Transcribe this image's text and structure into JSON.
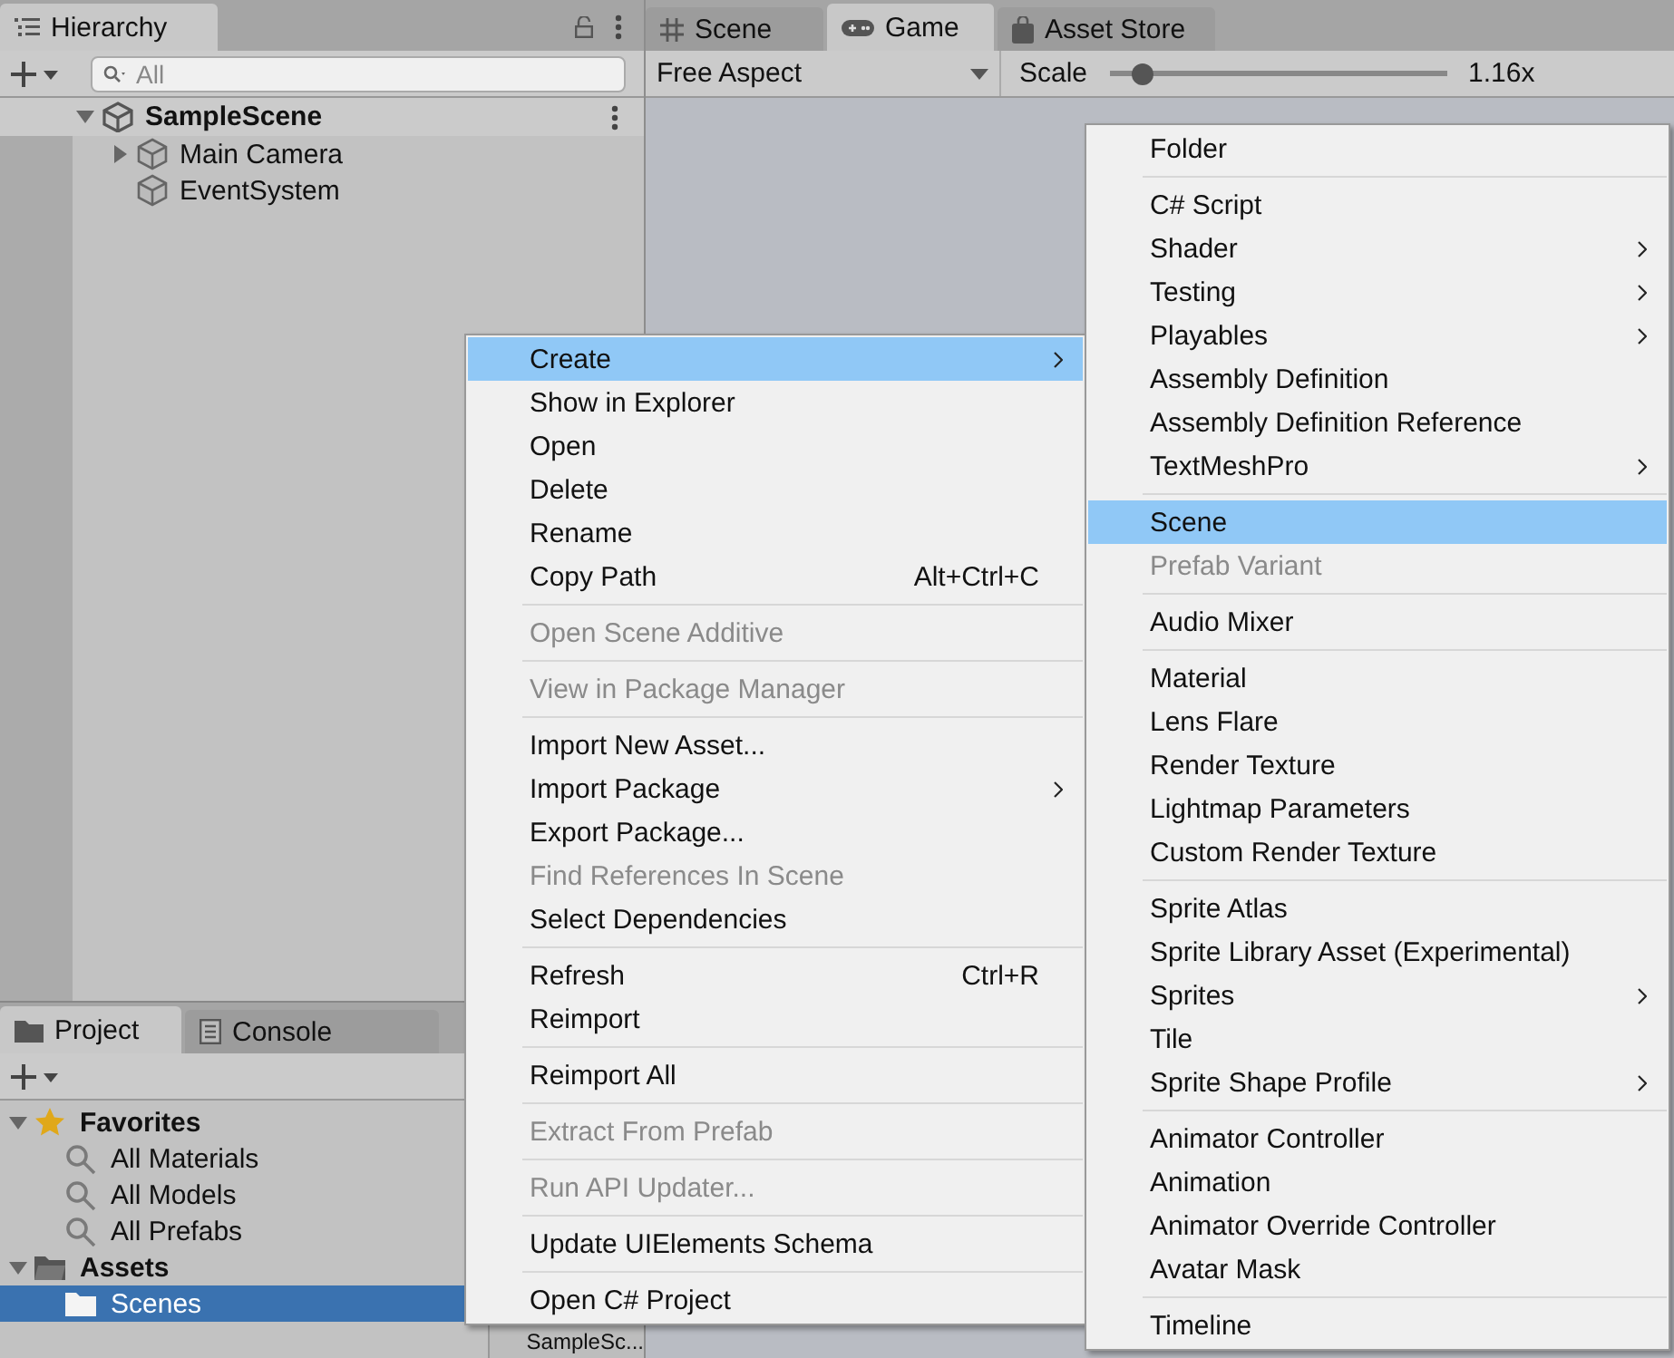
{
  "hierarchy": {
    "tabs": [
      {
        "label": "Hierarchy",
        "kind": "hierarchy",
        "selected": true
      }
    ],
    "search": {
      "placeholder": "All"
    },
    "tree": [
      {
        "label": "SampleScene",
        "kind": "scene",
        "expanded": true,
        "selected": false,
        "children": [
          {
            "label": "Main Camera",
            "kind": "gameobject",
            "expanded": false,
            "selected": false
          },
          {
            "label": "EventSystem",
            "kind": "gameobject",
            "selected": false
          }
        ]
      }
    ]
  },
  "view_tabs": [
    {
      "label": "Scene",
      "kind": "scene",
      "selected": false
    },
    {
      "label": "Game",
      "kind": "game",
      "selected": true
    },
    {
      "label": "Asset Store",
      "kind": "store",
      "selected": false
    }
  ],
  "game_toolbar": {
    "aspect": "Free Aspect",
    "scale_label": "Scale",
    "scale": {
      "level": 0.1
    },
    "scale_reading": "1.16x"
  },
  "project": {
    "tabs": [
      {
        "label": "Project",
        "kind": "project",
        "selected": true
      },
      {
        "label": "Console",
        "kind": "console",
        "selected": false
      }
    ],
    "tree": [
      {
        "label": "Favorites",
        "kind": "favorites",
        "expanded": true,
        "selected": false,
        "children": [
          {
            "label": "All Materials",
            "kind": "filter",
            "selected": false
          },
          {
            "label": "All Models",
            "kind": "filter",
            "selected": false
          },
          {
            "label": "All Prefabs",
            "kind": "filter",
            "selected": false
          }
        ]
      },
      {
        "label": "Assets",
        "kind": "folder",
        "expanded": true,
        "selected": false,
        "children": [
          {
            "label": "Scenes",
            "kind": "folder",
            "selected": true
          }
        ]
      }
    ],
    "assets": [
      {
        "label": "SampleSc..."
      }
    ]
  },
  "context_menu": [
    {
      "kind": "item",
      "label": "Create",
      "selected": true,
      "disabled": false,
      "submenu": true
    },
    {
      "kind": "item",
      "label": "Show in Explorer",
      "selected": false,
      "disabled": false,
      "submenu": false
    },
    {
      "kind": "item",
      "label": "Open",
      "selected": false,
      "disabled": false,
      "submenu": false
    },
    {
      "kind": "item",
      "label": "Delete",
      "selected": false,
      "disabled": false,
      "submenu": false
    },
    {
      "kind": "item",
      "label": "Rename",
      "selected": false,
      "disabled": false,
      "submenu": false
    },
    {
      "kind": "item",
      "label": "Copy Path",
      "shortcut": "Alt+Ctrl+C",
      "selected": false,
      "disabled": false,
      "submenu": false
    },
    {
      "kind": "separator"
    },
    {
      "kind": "item",
      "label": "Open Scene Additive",
      "selected": false,
      "disabled": true,
      "submenu": false
    },
    {
      "kind": "separator"
    },
    {
      "kind": "item",
      "label": "View in Package Manager",
      "selected": false,
      "disabled": true,
      "submenu": false
    },
    {
      "kind": "separator"
    },
    {
      "kind": "item",
      "label": "Import New Asset...",
      "selected": false,
      "disabled": false,
      "submenu": false
    },
    {
      "kind": "item",
      "label": "Import Package",
      "selected": false,
      "disabled": false,
      "submenu": true
    },
    {
      "kind": "item",
      "label": "Export Package...",
      "selected": false,
      "disabled": false,
      "submenu": false
    },
    {
      "kind": "item",
      "label": "Find References In Scene",
      "selected": false,
      "disabled": true,
      "submenu": false
    },
    {
      "kind": "item",
      "label": "Select Dependencies",
      "selected": false,
      "disabled": false,
      "submenu": false
    },
    {
      "kind": "separator"
    },
    {
      "kind": "item",
      "label": "Refresh",
      "shortcut": "Ctrl+R",
      "selected": false,
      "disabled": false,
      "submenu": false
    },
    {
      "kind": "item",
      "label": "Reimport",
      "selected": false,
      "disabled": false,
      "submenu": false
    },
    {
      "kind": "separator"
    },
    {
      "kind": "item",
      "label": "Reimport All",
      "selected": false,
      "disabled": false,
      "submenu": false
    },
    {
      "kind": "separator"
    },
    {
      "kind": "item",
      "label": "Extract From Prefab",
      "selected": false,
      "disabled": true,
      "submenu": false
    },
    {
      "kind": "separator"
    },
    {
      "kind": "item",
      "label": "Run API Updater...",
      "selected": false,
      "disabled": true,
      "submenu": false
    },
    {
      "kind": "separator"
    },
    {
      "kind": "item",
      "label": "Update UIElements Schema",
      "selected": false,
      "disabled": false,
      "submenu": false
    },
    {
      "kind": "separator"
    },
    {
      "kind": "item",
      "label": "Open C# Project",
      "selected": false,
      "disabled": false,
      "submenu": false
    }
  ],
  "create_submenu": [
    {
      "kind": "item",
      "label": "Folder",
      "selected": false,
      "disabled": false,
      "submenu": false
    },
    {
      "kind": "separator"
    },
    {
      "kind": "item",
      "label": "C# Script",
      "selected": false,
      "disabled": false,
      "submenu": false
    },
    {
      "kind": "item",
      "label": "Shader",
      "selected": false,
      "disabled": false,
      "submenu": true
    },
    {
      "kind": "item",
      "label": "Testing",
      "selected": false,
      "disabled": false,
      "submenu": true
    },
    {
      "kind": "item",
      "label": "Playables",
      "selected": false,
      "disabled": false,
      "submenu": true
    },
    {
      "kind": "item",
      "label": "Assembly Definition",
      "selected": false,
      "disabled": false,
      "submenu": false
    },
    {
      "kind": "item",
      "label": "Assembly Definition Reference",
      "selected": false,
      "disabled": false,
      "submenu": false
    },
    {
      "kind": "item",
      "label": "TextMeshPro",
      "selected": false,
      "disabled": false,
      "submenu": true
    },
    {
      "kind": "separator"
    },
    {
      "kind": "item",
      "label": "Scene",
      "selected": true,
      "disabled": false,
      "submenu": false
    },
    {
      "kind": "item",
      "label": "Prefab Variant",
      "selected": false,
      "disabled": true,
      "submenu": false
    },
    {
      "kind": "separator"
    },
    {
      "kind": "item",
      "label": "Audio Mixer",
      "selected": false,
      "disabled": false,
      "submenu": false
    },
    {
      "kind": "separator"
    },
    {
      "kind": "item",
      "label": "Material",
      "selected": false,
      "disabled": false,
      "submenu": false
    },
    {
      "kind": "item",
      "label": "Lens Flare",
      "selected": false,
      "disabled": false,
      "submenu": false
    },
    {
      "kind": "item",
      "label": "Render Texture",
      "selected": false,
      "disabled": false,
      "submenu": false
    },
    {
      "kind": "item",
      "label": "Lightmap Parameters",
      "selected": false,
      "disabled": false,
      "submenu": false
    },
    {
      "kind": "item",
      "label": "Custom Render Texture",
      "selected": false,
      "disabled": false,
      "submenu": false
    },
    {
      "kind": "separator"
    },
    {
      "kind": "item",
      "label": "Sprite Atlas",
      "selected": false,
      "disabled": false,
      "submenu": false
    },
    {
      "kind": "item",
      "label": "Sprite Library Asset (Experimental)",
      "selected": false,
      "disabled": false,
      "submenu": false
    },
    {
      "kind": "item",
      "label": "Sprites",
      "selected": false,
      "disabled": false,
      "submenu": true
    },
    {
      "kind": "item",
      "label": "Tile",
      "selected": false,
      "disabled": false,
      "submenu": false
    },
    {
      "kind": "item",
      "label": "Sprite Shape Profile",
      "selected": false,
      "disabled": false,
      "submenu": true
    },
    {
      "kind": "separator"
    },
    {
      "kind": "item",
      "label": "Animator Controller",
      "selected": false,
      "disabled": false,
      "submenu": false
    },
    {
      "kind": "item",
      "label": "Animation",
      "selected": false,
      "disabled": false,
      "submenu": false
    },
    {
      "kind": "item",
      "label": "Animator Override Controller",
      "selected": false,
      "disabled": false,
      "submenu": false
    },
    {
      "kind": "item",
      "label": "Avatar Mask",
      "selected": false,
      "disabled": false,
      "submenu": false
    },
    {
      "kind": "separator"
    },
    {
      "kind": "item",
      "label": "Timeline",
      "selected": false,
      "disabled": false,
      "submenu": false
    }
  ]
}
